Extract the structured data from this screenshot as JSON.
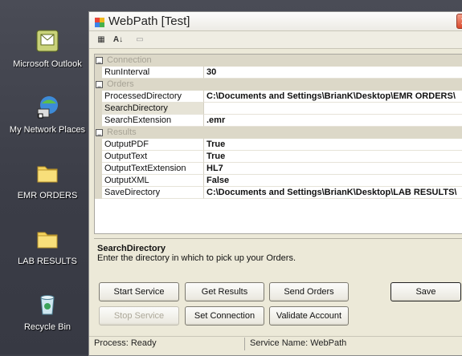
{
  "window": {
    "title": "WebPath [Test]",
    "close_glyph": "✕"
  },
  "desktop_icons": [
    {
      "label": "Microsoft Outlook",
      "icon": "outlook-icon"
    },
    {
      "label": "My Network Places",
      "icon": "network-places-icon"
    },
    {
      "label": "EMR ORDERS",
      "icon": "folder-icon"
    },
    {
      "label": "LAB RESULTS",
      "icon": "folder-icon"
    },
    {
      "label": "Recycle Bin",
      "icon": "recycle-bin-icon"
    }
  ],
  "toolbar": {
    "categorized_glyph": "▦",
    "alphabetical_glyph": "A↓",
    "property_pages_glyph": "▭"
  },
  "grid": {
    "categories": {
      "connection": "Connection",
      "orders": "Orders",
      "results": "Results"
    },
    "toggle_glyph": "−",
    "rows": {
      "run_interval": {
        "name": "RunInterval",
        "value": "30"
      },
      "processed_directory": {
        "name": "ProcessedDirectory",
        "value": "C:\\Documents and Settings\\BrianK\\Desktop\\EMR ORDERS\\"
      },
      "search_directory": {
        "name": "SearchDirectory",
        "value": ""
      },
      "search_extension": {
        "name": "SearchExtension",
        "value": ".emr"
      },
      "output_pdf": {
        "name": "OutputPDF",
        "value": "True"
      },
      "output_text": {
        "name": "OutputText",
        "value": "True"
      },
      "output_text_extension": {
        "name": "OutputTextExtension",
        "value": "HL7"
      },
      "output_xml": {
        "name": "OutputXML",
        "value": "False"
      },
      "save_directory": {
        "name": "SaveDirectory",
        "value": "C:\\Documents and Settings\\BrianK\\Desktop\\LAB RESULTS\\"
      }
    }
  },
  "help": {
    "title": "SearchDirectory",
    "description": "Enter the directory in which to pick up your Orders."
  },
  "buttons": {
    "start_service": "Start Service",
    "get_results": "Get Results",
    "send_orders": "Send Orders",
    "save": "Save",
    "stop_service": "Stop Service",
    "set_connection": "Set Connection",
    "validate_account": "Validate Account"
  },
  "status": {
    "process": "Process: Ready",
    "service_name": "Service Name: WebPath"
  }
}
